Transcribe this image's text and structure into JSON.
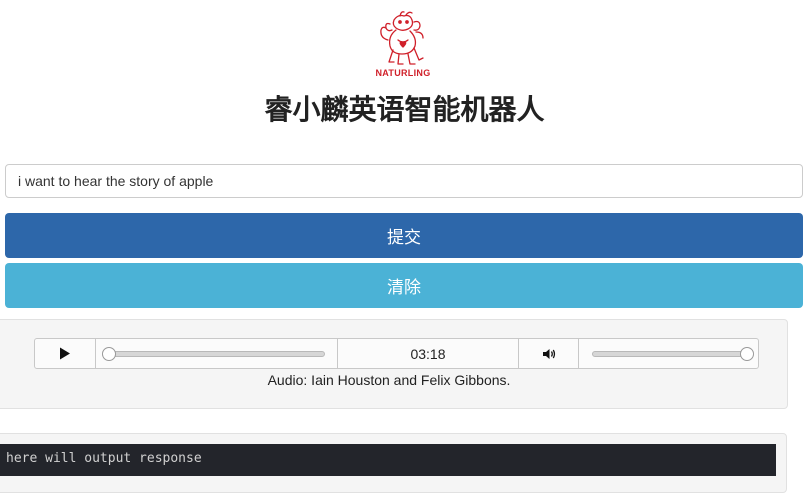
{
  "logo": {
    "brand_text": "NATURLING"
  },
  "title": "睿小麟英语智能机器人",
  "query": {
    "value": "i want to hear the story of apple"
  },
  "buttons": {
    "submit": "提交",
    "clear": "清除"
  },
  "audio": {
    "time": "03:18",
    "credit": "Audio: Iain Houston and Felix Gibbons.",
    "progress": 0,
    "volume": 1
  },
  "output": {
    "text": "here will output response"
  },
  "colors": {
    "submit_button": "#2d67aa",
    "clear_button": "#4bb2d6",
    "output_background": "#23252b",
    "logo_red": "#d0202a"
  }
}
